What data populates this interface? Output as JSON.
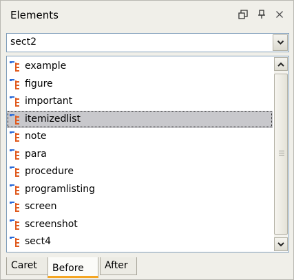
{
  "panel": {
    "title": "Elements",
    "buttons": [
      {
        "name": "restore-icon"
      },
      {
        "name": "pin-icon"
      },
      {
        "name": "close-icon"
      }
    ]
  },
  "combo": {
    "value": "sect2",
    "arrow_icon": "chevron-down-icon"
  },
  "list": {
    "item_icon": "element-tree-icon",
    "items": [
      {
        "label": "example",
        "selected": false
      },
      {
        "label": "figure",
        "selected": false
      },
      {
        "label": "important",
        "selected": false
      },
      {
        "label": "itemizedlist",
        "selected": true
      },
      {
        "label": "note",
        "selected": false
      },
      {
        "label": "para",
        "selected": false
      },
      {
        "label": "procedure",
        "selected": false
      },
      {
        "label": "programlisting",
        "selected": false
      },
      {
        "label": "screen",
        "selected": false
      },
      {
        "label": "screenshot",
        "selected": false
      },
      {
        "label": "sect4",
        "selected": false
      }
    ]
  },
  "tabs": [
    {
      "label": "Caret",
      "active": false
    },
    {
      "label": "Before",
      "active": true
    },
    {
      "label": "After",
      "active": false
    }
  ],
  "colors": {
    "selection": "#c8c8cc",
    "active_tab_accent": "#f5a623",
    "icon_blue": "#2a6ad8",
    "icon_orange": "#e05a1e"
  }
}
